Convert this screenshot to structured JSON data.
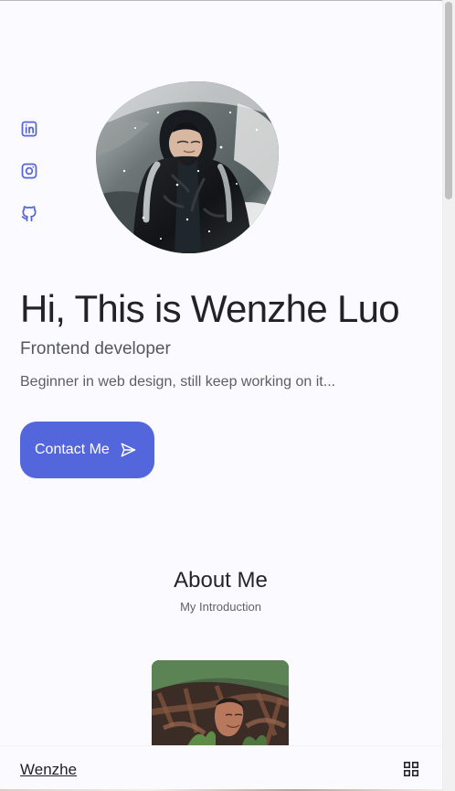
{
  "profile": {
    "greeting": "Hi, This is Wenzhe Luo",
    "role": "Frontend developer",
    "description": "Beginner in web design, still keep working on it..."
  },
  "actions": {
    "contact_label": "Contact Me",
    "menu_label": "Menu"
  },
  "social_links": [
    {
      "name": "LinkedIn",
      "icon": "linkedin-icon"
    },
    {
      "name": "Instagram",
      "icon": "instagram-icon"
    },
    {
      "name": "GitHub",
      "icon": "github-icon"
    }
  ],
  "about": {
    "title": "About Me",
    "subtitle": "My Introduction"
  },
  "navigation": {
    "brand": "Wenzhe",
    "menu_icon": "grid-icon"
  },
  "colors": {
    "accent": "#5466dc",
    "background": "#fbfbff",
    "text": "#24242b",
    "muted_text": "#5d5d67",
    "social_icon": "#5666d8"
  }
}
